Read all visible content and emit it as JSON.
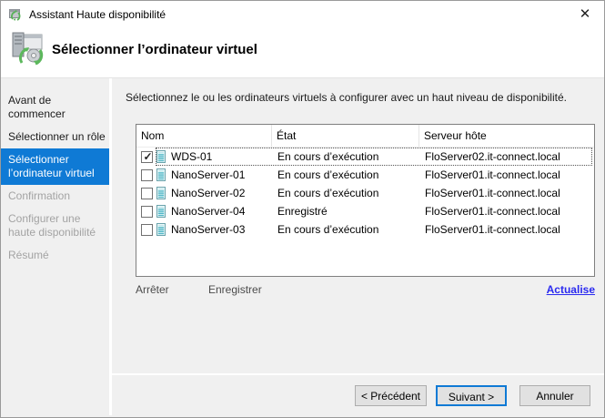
{
  "window": {
    "title": "Assistant Haute disponibilité",
    "close_glyph": "✕"
  },
  "header": {
    "title": "Sélectionner l’ordinateur virtuel"
  },
  "sidebar": {
    "items": [
      {
        "label": "Avant de commencer",
        "state": "enabled"
      },
      {
        "label": "Sélectionner un rôle",
        "state": "enabled"
      },
      {
        "label": "Sélectionner l’ordinateur virtuel",
        "state": "selected"
      },
      {
        "label": "Confirmation",
        "state": "disabled"
      },
      {
        "label": "Configurer une haute disponibilité",
        "state": "disabled"
      },
      {
        "label": "Résumé",
        "state": "disabled"
      }
    ]
  },
  "main": {
    "instruction": "Sélectionnez le ou les ordinateurs virtuels à configurer avec un haut niveau de disponibilité.",
    "table": {
      "columns": [
        "Nom",
        "État",
        "Serveur hôte"
      ],
      "rows": [
        {
          "checked": true,
          "focused": true,
          "name": "WDS-01",
          "state": "En cours d’exécution",
          "host": "FloServer02.it-connect.local"
        },
        {
          "checked": false,
          "focused": false,
          "name": "NanoServer-01",
          "state": "En cours d’exécution",
          "host": "FloServer01.it-connect.local"
        },
        {
          "checked": false,
          "focused": false,
          "name": "NanoServer-02",
          "state": "En cours d’exécution",
          "host": "FloServer01.it-connect.local"
        },
        {
          "checked": false,
          "focused": false,
          "name": "NanoServer-04",
          "state": "Enregistré",
          "host": "FloServer01.it-connect.local"
        },
        {
          "checked": false,
          "focused": false,
          "name": "NanoServer-03",
          "state": "En cours d’exécution",
          "host": "FloServer01.it-connect.local"
        }
      ]
    },
    "actions": {
      "stop": "Arrêter",
      "save": "Enregistrer",
      "refresh": "Actualise"
    }
  },
  "footer": {
    "back": "< Précédent",
    "next": "Suivant >",
    "cancel": "Annuler"
  },
  "colors": {
    "accent": "#0f7ad5",
    "link": "#2a2af0",
    "disabled_text": "#a3a3a3"
  }
}
